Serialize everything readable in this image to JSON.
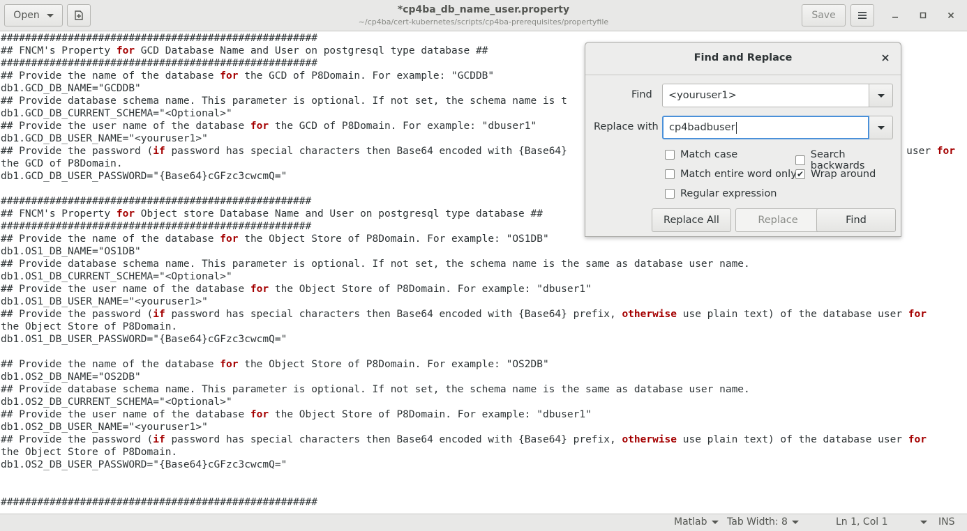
{
  "header": {
    "open_label": "Open",
    "title": "*cp4ba_db_name_user.property",
    "subtitle": "~/cp4ba/cert-kubernetes/scripts/cp4ba-prerequisites/propertyfile",
    "save_label": "Save",
    "minimize_glyph": "–",
    "maximize_glyph": "□",
    "close_glyph": "✕"
  },
  "editor": {
    "lines": [
      "####################################################",
      "## FNCM's Property for GCD Database Name and User on postgresql type database ##",
      "####################################################",
      "## Provide the name of the database for the GCD of P8Domain. For example: \"GCDDB\"",
      "db1.GCD_DB_NAME=\"GCDDB\"",
      "## Provide database schema name. This parameter is optional. If not set, the schema name is t",
      "db1.GCD_DB_CURRENT_SCHEMA=\"<Optional>\"",
      "## Provide the user name of the database for the GCD of P8Domain. For example: \"dbuser1\"",
      "db1.GCD_DB_USER_NAME=\"<youruser1>\"",
      "## Provide the password (if password has special characters then Base64 encoded with {Base64}",
      "the GCD of P8Domain.",
      "db1.GCD_DB_USER_PASSWORD=\"{Base64}cGFzc3cwcmQ=\"",
      "",
      "###################################################",
      "## FNCM's Property for Object store Database Name and User on postgresql type database ##",
      "###################################################",
      "## Provide the name of the database for the Object Store of P8Domain. For example: \"OS1DB\"",
      "db1.OS1_DB_NAME=\"OS1DB\"",
      "## Provide database schema name. This parameter is optional. If not set, the schema name is the same as database user name.",
      "db1.OS1_DB_CURRENT_SCHEMA=\"<Optional>\"",
      "## Provide the user name of the database for the Object Store of P8Domain. For example: \"dbuser1\"",
      "db1.OS1_DB_USER_NAME=\"<youruser1>\"",
      "## Provide the password (if password has special characters then Base64 encoded with {Base64} prefix, otherwise use plain text) of the database user for",
      "the Object Store of P8Domain.",
      "db1.OS1_DB_USER_PASSWORD=\"{Base64}cGFzc3cwcmQ=\"",
      "",
      "## Provide the name of the database for the Object Store of P8Domain. For example: \"OS2DB\"",
      "db1.OS2_DB_NAME=\"OS2DB\"",
      "## Provide database schema name. This parameter is optional. If not set, the schema name is the same as database user name.",
      "db1.OS2_DB_CURRENT_SCHEMA=\"<Optional>\"",
      "## Provide the user name of the database for the Object Store of P8Domain. For example: \"dbuser1\"",
      "db1.OS2_DB_USER_NAME=\"<youruser1>\"",
      "## Provide the password (if password has special characters then Base64 encoded with {Base64} prefix, otherwise use plain text) of the database user for",
      "the Object Store of P8Domain.",
      "db1.OS2_DB_USER_PASSWORD=\"{Base64}cGFzc3cwcmQ=\"",
      "",
      "",
      "####################################################"
    ],
    "line10_overflow": "user for"
  },
  "dialog": {
    "title": "Find and Replace",
    "find_label": "Find",
    "find_value": "<youruser1>",
    "replace_label": "Replace with",
    "replace_value": "cp4badbuser",
    "options": [
      {
        "label": "Match case",
        "checked": false
      },
      {
        "label": "Search backwards",
        "checked": false
      },
      {
        "label": "Match entire word only",
        "checked": false
      },
      {
        "label": "Wrap around",
        "checked": true
      },
      {
        "label": "Regular expression",
        "checked": false
      }
    ],
    "replace_all_label": "Replace All",
    "replace_label_btn": "Replace",
    "find_btn_label": "Find"
  },
  "statusbar": {
    "language": "Matlab",
    "tab_width": "Tab Width: 8",
    "position": "Ln 1, Col 1",
    "mode": "INS"
  },
  "colors": {
    "keyword": "#a40000",
    "accent": "#4a90d9",
    "chrome": "#e8e8e7"
  }
}
